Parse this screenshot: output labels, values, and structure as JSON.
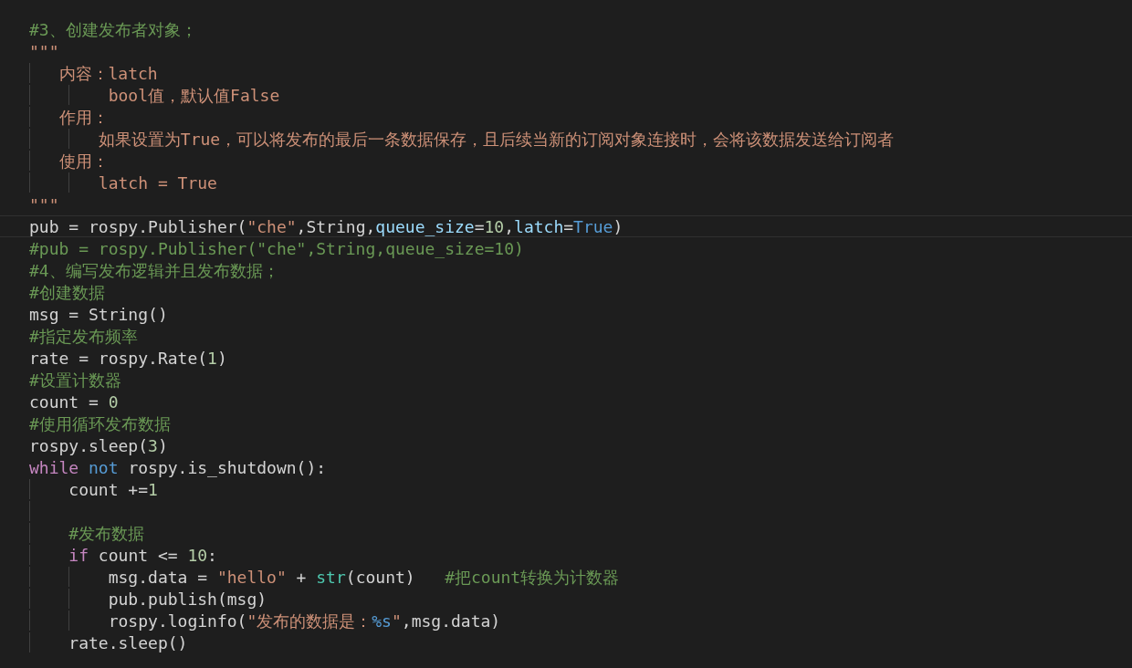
{
  "editor": {
    "lines": [
      {
        "kind": "code",
        "current": false,
        "tokens": [
          {
            "kind": "comment",
            "text": "#3、创建发布者对象；"
          }
        ]
      },
      {
        "kind": "code",
        "current": false,
        "tokens": [
          {
            "kind": "string",
            "text": "\"\"\""
          }
        ]
      },
      {
        "kind": "code",
        "current": false,
        "tokens": [
          {
            "kind": "string",
            "text": "   内容：latch"
          }
        ]
      },
      {
        "kind": "code",
        "current": false,
        "tokens": [
          {
            "kind": "string",
            "text": "        bool值，默认值False"
          }
        ]
      },
      {
        "kind": "code",
        "current": false,
        "tokens": [
          {
            "kind": "string",
            "text": "   作用："
          }
        ]
      },
      {
        "kind": "code",
        "current": false,
        "tokens": [
          {
            "kind": "string",
            "text": "       如果设置为True，可以将发布的最后一条数据保存，且后续当新的订阅对象连接时，会将该数据发送给订阅者"
          }
        ]
      },
      {
        "kind": "code",
        "current": false,
        "tokens": [
          {
            "kind": "string",
            "text": "   使用："
          }
        ]
      },
      {
        "kind": "code",
        "current": false,
        "tokens": [
          {
            "kind": "string",
            "text": "       latch = True"
          }
        ]
      },
      {
        "kind": "code",
        "current": false,
        "tokens": [
          {
            "kind": "string",
            "text": "\"\"\""
          }
        ]
      },
      {
        "kind": "code",
        "current": true,
        "tokens": [
          {
            "kind": "plain",
            "text": "pub = rospy.Publisher("
          },
          {
            "kind": "string",
            "text": "\"che\""
          },
          {
            "kind": "plain",
            "text": ",String,"
          },
          {
            "kind": "param",
            "text": "queue_size"
          },
          {
            "kind": "plain",
            "text": "="
          },
          {
            "kind": "number",
            "text": "10"
          },
          {
            "kind": "plain",
            "text": ","
          },
          {
            "kind": "param",
            "text": "latch"
          },
          {
            "kind": "plain",
            "text": "="
          },
          {
            "kind": "constant",
            "text": "True"
          },
          {
            "kind": "plain",
            "text": ")"
          }
        ]
      },
      {
        "kind": "code",
        "current": false,
        "tokens": [
          {
            "kind": "comment",
            "text": "#pub = rospy.Publisher(\"che\",String,queue_size=10)"
          }
        ]
      },
      {
        "kind": "code",
        "current": false,
        "tokens": [
          {
            "kind": "comment",
            "text": "#4、编写发布逻辑并且发布数据；"
          }
        ]
      },
      {
        "kind": "code",
        "current": false,
        "tokens": [
          {
            "kind": "comment",
            "text": "#创建数据"
          }
        ]
      },
      {
        "kind": "code",
        "current": false,
        "tokens": [
          {
            "kind": "plain",
            "text": "msg = String()"
          }
        ]
      },
      {
        "kind": "code",
        "current": false,
        "tokens": [
          {
            "kind": "comment",
            "text": "#指定发布频率"
          }
        ]
      },
      {
        "kind": "code",
        "current": false,
        "tokens": [
          {
            "kind": "plain",
            "text": "rate = rospy.Rate("
          },
          {
            "kind": "number",
            "text": "1"
          },
          {
            "kind": "plain",
            "text": ")"
          }
        ]
      },
      {
        "kind": "code",
        "current": false,
        "tokens": [
          {
            "kind": "comment",
            "text": "#设置计数器"
          }
        ]
      },
      {
        "kind": "code",
        "current": false,
        "tokens": [
          {
            "kind": "plain",
            "text": "count = "
          },
          {
            "kind": "number",
            "text": "0"
          }
        ]
      },
      {
        "kind": "code",
        "current": false,
        "tokens": [
          {
            "kind": "comment",
            "text": "#使用循环发布数据"
          }
        ]
      },
      {
        "kind": "code",
        "current": false,
        "tokens": [
          {
            "kind": "plain",
            "text": "rospy.sleep("
          },
          {
            "kind": "number",
            "text": "3"
          },
          {
            "kind": "plain",
            "text": ")"
          }
        ]
      },
      {
        "kind": "code",
        "current": false,
        "tokens": [
          {
            "kind": "control",
            "text": "while"
          },
          {
            "kind": "constant",
            "text": " not"
          },
          {
            "kind": "plain",
            "text": " rospy.is_shutdown():"
          }
        ]
      },
      {
        "kind": "code",
        "current": false,
        "tokens": [
          {
            "kind": "plain",
            "text": "    count +="
          },
          {
            "kind": "number",
            "text": "1"
          }
        ]
      },
      {
        "kind": "blank"
      },
      {
        "kind": "code",
        "current": false,
        "tokens": [
          {
            "kind": "comment",
            "text": "    #发布数据"
          }
        ]
      },
      {
        "kind": "code",
        "current": false,
        "tokens": [
          {
            "kind": "control",
            "text": "    if"
          },
          {
            "kind": "plain",
            "text": " count <= "
          },
          {
            "kind": "number",
            "text": "10"
          },
          {
            "kind": "plain",
            "text": ":"
          }
        ]
      },
      {
        "kind": "code",
        "current": false,
        "tokens": [
          {
            "kind": "plain",
            "text": "        msg.data = "
          },
          {
            "kind": "string",
            "text": "\"hello\""
          },
          {
            "kind": "plain",
            "text": " + "
          },
          {
            "kind": "builtin",
            "text": "str"
          },
          {
            "kind": "plain",
            "text": "(count)   "
          },
          {
            "kind": "comment",
            "text": "#把count转换为计数器"
          }
        ]
      },
      {
        "kind": "code",
        "current": false,
        "tokens": [
          {
            "kind": "plain",
            "text": "        pub.publish(msg)"
          }
        ]
      },
      {
        "kind": "code",
        "current": false,
        "tokens": [
          {
            "kind": "plain",
            "text": "        rospy.loginfo("
          },
          {
            "kind": "string",
            "text": "\"发布的数据是："
          },
          {
            "kind": "constant",
            "text": "%s"
          },
          {
            "kind": "string",
            "text": "\""
          },
          {
            "kind": "plain",
            "text": ",msg.data)"
          }
        ]
      },
      {
        "kind": "code",
        "current": false,
        "tokens": [
          {
            "kind": "plain",
            "text": "    rate.sleep()"
          }
        ]
      }
    ]
  }
}
